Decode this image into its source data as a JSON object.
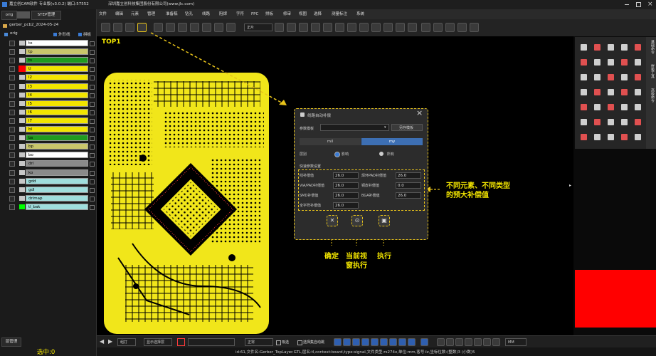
{
  "window": {
    "title": "嘉立创CAM软件 专业版(v3.0.2) 端口:57552",
    "company": "深圳嘉立创科技集团股份有限公司(www.jlc.com)"
  },
  "left_panel": {
    "tabs": [
      "orig",
      "STEP管理"
    ],
    "job_name": "gerber_pcb2_2024-05-24",
    "step": "orig",
    "options": [
      "外形线",
      "拼板"
    ],
    "layers": [
      {
        "name": "to",
        "name_bg": "#ffffff",
        "swatch": "#c8c8c8",
        "highlight": false
      },
      {
        "name": "tp",
        "name_bg": "#c9c66b",
        "swatch": "#c8c8c8",
        "highlight": false
      },
      {
        "name": "ts",
        "name_bg": "#1f9a1f",
        "swatch": "#c8c8c8",
        "highlight": false
      },
      {
        "name": "tl",
        "name_bg": "#f2e500",
        "swatch": "#ff0000",
        "highlight": true
      },
      {
        "name": "l2",
        "name_bg": "#f2e500",
        "swatch": "#c8c8c8",
        "highlight": false
      },
      {
        "name": "l3",
        "name_bg": "#f2e500",
        "swatch": "#c8c8c8",
        "highlight": false
      },
      {
        "name": "l4",
        "name_bg": "#f2e500",
        "swatch": "#c8c8c8",
        "highlight": false
      },
      {
        "name": "l5",
        "name_bg": "#f2e500",
        "swatch": "#c8c8c8",
        "highlight": false
      },
      {
        "name": "l6",
        "name_bg": "#f2e500",
        "swatch": "#c8c8c8",
        "highlight": false
      },
      {
        "name": "l7",
        "name_bg": "#f2e500",
        "swatch": "#c8c8c8",
        "highlight": false
      },
      {
        "name": "bl",
        "name_bg": "#f2e500",
        "swatch": "#c8c8c8",
        "highlight": false
      },
      {
        "name": "bs",
        "name_bg": "#1f9a1f",
        "swatch": "#c8c8c8",
        "highlight": false
      },
      {
        "name": "bp",
        "name_bg": "#c9c66b",
        "swatch": "#c8c8c8",
        "highlight": false
      },
      {
        "name": "bo",
        "name_bg": "#ffffff",
        "swatch": "#c8c8c8",
        "highlight": false
      },
      {
        "name": "drl",
        "name_bg": "#8a8a8a",
        "swatch": "#c8c8c8",
        "highlight": false
      },
      {
        "name": "ko",
        "name_bg": "#8a8a8a",
        "swatch": "#c8c8c8",
        "highlight": false
      },
      {
        "name": "gdd",
        "name_bg": "#9fdedd",
        "swatch": "#c8c8c8",
        "highlight": false
      },
      {
        "name": "gdl",
        "name_bg": "#9fdedd",
        "swatch": "#c8c8c8",
        "highlight": false
      },
      {
        "name": "drlmap",
        "name_bg": "#9fdedd",
        "swatch": "#c8c8c8",
        "highlight": false
      },
      {
        "name": "tl_bak",
        "name_bg": "#9fdedd",
        "swatch": "#00ff00",
        "highlight": false
      }
    ],
    "footer_tab": "层管理",
    "selection_label": "选中:0"
  },
  "menu": [
    "文件",
    "编辑",
    "元素",
    "管理",
    "准备稿",
    "钻孔",
    "线路",
    "阻焊",
    "字符",
    "FPC",
    "拼板",
    "修审",
    "视图",
    "选择",
    "测量标注",
    "系统"
  ],
  "toolbar": {
    "dropdown_value": "正片",
    "icons": [
      "probe-icon",
      "circle-icon",
      "pen-icon",
      "wrench-icon",
      "wrench-alt-icon",
      "grid-icon",
      "ring-icon",
      "dot-icon",
      "arc-icon",
      "target-icon",
      "rect-icon",
      "list-icon",
      "layers-icon",
      "doc-icon",
      "chip-icon",
      "table-icon",
      "trace-icon",
      "pad-icon",
      "via-icon",
      "bga-icon",
      "arrow-icon",
      "gear-icon",
      "person-icon",
      "stack-icon",
      "board-icon",
      "box-icon",
      "compare-icon",
      "record-icon"
    ]
  },
  "canvas": {
    "step_label": "TOP1"
  },
  "dialog": {
    "title": "线路自动补偿",
    "template_label": "参数模板",
    "save_template": "另存模板",
    "unit_left": "mil",
    "unit_right": "my",
    "scope_label": "层别",
    "scope_opt1": "影响",
    "scope_opt2": "所有",
    "quick_label": "快速参数设置",
    "fields": [
      {
        "label": "线补偿值",
        "value": "26.0"
      },
      {
        "label": "焊环PAD补偿值",
        "value": "26.0"
      },
      {
        "label": "VIA/PAD补偿值",
        "value": "26.0"
      },
      {
        "label": "铜皮补偿值",
        "value": "0.0"
      },
      {
        "label": "SMD补偿值",
        "value": "26.0"
      },
      {
        "label": "BGA补偿值",
        "value": "26.0"
      },
      {
        "label": "全字符补偿值",
        "value": "26.0"
      }
    ]
  },
  "annotations": {
    "callout": "不同元素、不同类型\n的预大补偿值",
    "confirm": "确定",
    "run_view": "当前视\n窗执行",
    "execute": "执行"
  },
  "side_tabs": [
    "基础命令",
    "拼板工具",
    "高级命令"
  ],
  "bottom": {
    "zoom_dropdown": "组打",
    "view_btn": "显示选择层",
    "layer_dropdown": "正常",
    "checkbox1": "吸选",
    "checkbox2": "选择集自动跳",
    "unit": "MM"
  },
  "status": "id:61,文件名:Gerber_TopLayer.GTL,层名:tl,context:board,type:signal,文件类型:rs274x,单位:mm,客号:lz,坐标位数:(整数)3 (小数)5"
}
